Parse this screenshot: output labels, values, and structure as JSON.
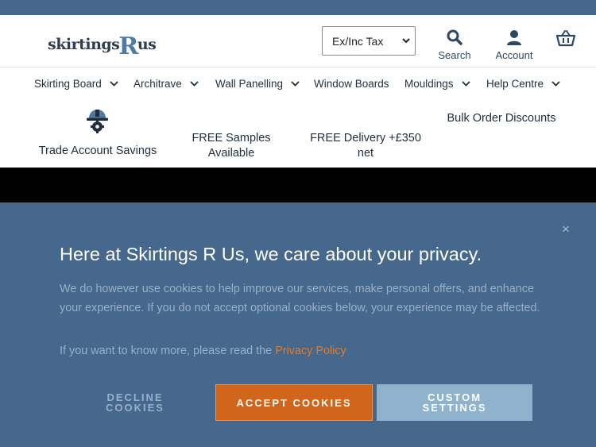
{
  "header": {
    "logo_prefix": "skirtings",
    "logo_r": "R",
    "logo_suffix": "us",
    "tax_select": "Ex/Inc Tax",
    "search_label": "Search",
    "account_label": "Account"
  },
  "nav": {
    "items": [
      {
        "label": "Skirting Board"
      },
      {
        "label": "Architrave"
      },
      {
        "label": "Wall Panelling"
      },
      {
        "label": "Window Boards"
      },
      {
        "label": "Mouldings"
      },
      {
        "label": "Help Centre"
      }
    ]
  },
  "usps": {
    "trade": "Trade Account Savings",
    "samples_line1": "FREE Samples",
    "samples_line2": "Available",
    "delivery_line1": "FREE Delivery +£350",
    "delivery_line2": "net",
    "bulk": "Bulk Order Discounts"
  },
  "cookie": {
    "close": "×",
    "title": "Here at Skirtings R Us, we care about your privacy.",
    "body": "We do however use cookies to help improve our services, make personal offers, and enhance your experience. If you do not accept optional cookies below, your experience may be affected.",
    "more_prefix": "If you want to know more, please read the ",
    "privacy_link": "Privacy Policy",
    "decline_line1": "DECLINE",
    "decline_line2": "COOKIES",
    "accept": "ACCEPT COOKIES",
    "custom_line1": "CUSTOM",
    "custom_line2": "SETTINGS"
  },
  "colors": {
    "brand_blue": "#45688c",
    "accept_orange": "#d0651b",
    "custom_blue": "#8fb3cc"
  },
  "icons": {
    "search": "search-icon",
    "account": "account-icon",
    "basket": "basket-icon",
    "trade": "hard-hat-gear-icon",
    "chevron": "chevron-down-icon",
    "close": "close-icon"
  }
}
